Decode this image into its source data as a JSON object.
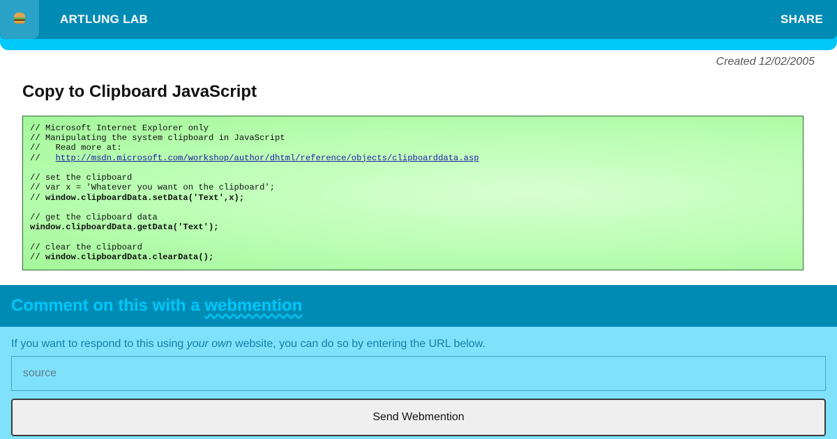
{
  "header": {
    "menu_icon": "hamburger-icon",
    "brand": "ARTLUNG LAB",
    "share": "SHARE"
  },
  "meta": {
    "created": "Created 12/02/2005"
  },
  "article": {
    "title": "Copy to Clipboard JavaScript",
    "code": {
      "l1": "// Microsoft Internet Explorer only",
      "l2": "// Manipulating the system clipboard in JavaScript",
      "l3": "//   Read more at:",
      "l4_prefix": "//   ",
      "l4_link": "http://msdn.microsoft.com/workshop/author/dhtml/reference/objects/clipboarddata.asp",
      "l5": "// set the clipboard",
      "l6": "// var x = 'Whatever you want on the clipboard';",
      "l7_prefix": "// ",
      "l7_bold": "window.clipboardData.setData('Text',x);",
      "l8": "// get the clipboard data",
      "l9_bold": "window.clipboardData.getData('Text');",
      "l10": "// clear the clipboard",
      "l11_prefix": "// ",
      "l11_bold": "window.clipboardData.clearData();"
    }
  },
  "comment": {
    "title_prefix": "Comment on this with a ",
    "title_link": "webmention",
    "text_before": "If you want to respond to this using ",
    "text_em": "your own",
    "text_after": " website, you can do so by entering the URL below.",
    "input_placeholder": "source",
    "input_value": "",
    "button": "Send Webmention"
  },
  "colors": {
    "header_dark": "#008bb5",
    "header_accent": "#00c8f8",
    "comment_bg": "#80e1fb",
    "code_bg": "#bfffb8"
  }
}
